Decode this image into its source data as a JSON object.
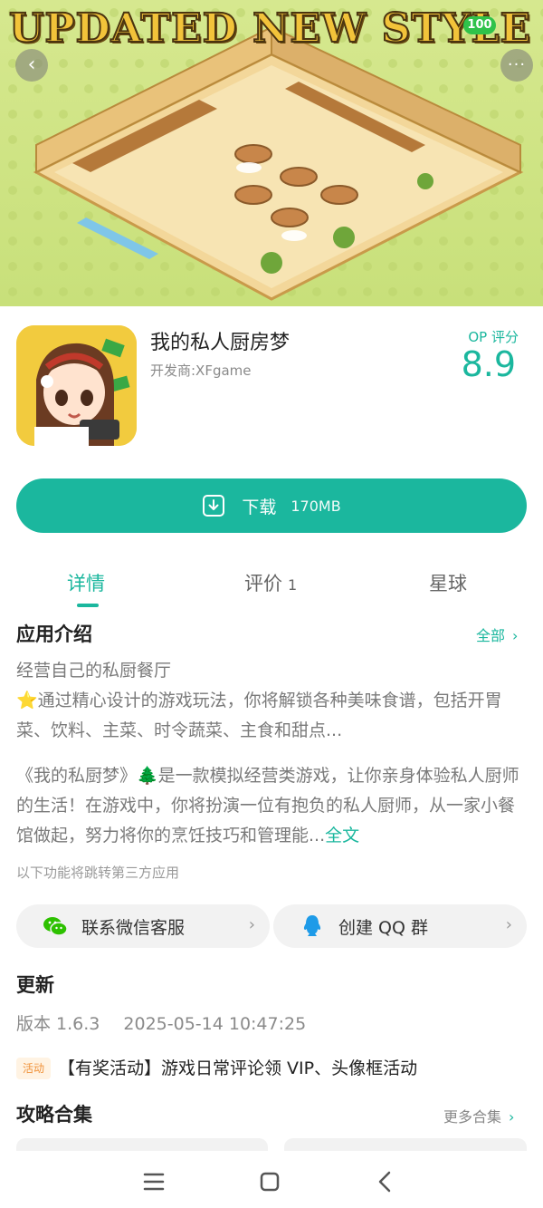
{
  "hero": {
    "banner": "UPDATED NEW STYLE",
    "battery": "100",
    "back_glyph": "‹",
    "more_glyph": "···"
  },
  "app": {
    "name": "我的私人厨房梦",
    "developer": "开发商:XFgame",
    "rating_label": "OP 评分",
    "rating_value": "8.9"
  },
  "download": {
    "label": "下载",
    "size": "170MB"
  },
  "tabs": [
    {
      "label": "详情",
      "count": ""
    },
    {
      "label": "评价",
      "count": "1"
    },
    {
      "label": "星球",
      "count": ""
    }
  ],
  "intro": {
    "title": "应用介绍",
    "all_link": "全部",
    "line1": "经营自己的私厨餐厅",
    "line2": "⭐通过精心设计的游戏玩法，你将解锁各种美味食谱，包括开胃菜、饮料、主菜、时令蔬菜、主食和甜点...",
    "line3": "《我的私厨梦》🌲是一款模拟经营类游戏，让你亲身体验私人厨师的生活！在游戏中，你将扮演一位有抱负的私人厨师，从一家小餐馆做起，努力将你的烹饪技巧和管理能...",
    "full_text_link": "全文",
    "third_party_note": "以下功能将跳转第三方应用"
  },
  "contacts": [
    {
      "label": "联系微信客服",
      "icon": "wechat-icon"
    },
    {
      "label": "创建 QQ 群",
      "icon": "qq-icon"
    }
  ],
  "update": {
    "title": "更新",
    "version": "版本 1.6.3",
    "timestamp": "2025-05-14 10:47:25",
    "event_badge": "活动",
    "event_text": "【有奖活动】游戏日常评论领 VIP、头像框活动"
  },
  "guides": {
    "title": "攻略合集",
    "more_link": "更多合集"
  },
  "colors": {
    "accent": "#1bb79e",
    "hero_bg": "#c8e07a",
    "event_orange": "#f0923a"
  }
}
